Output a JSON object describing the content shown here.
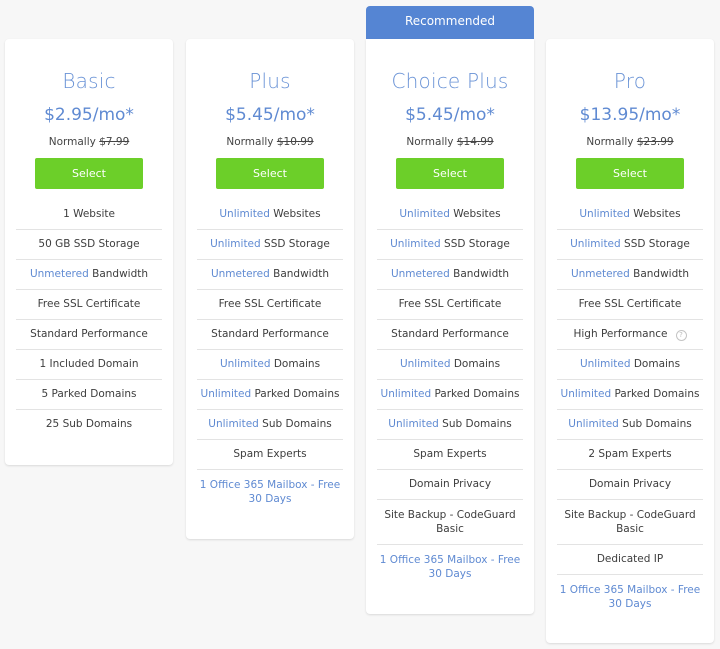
{
  "recommended_label": "Recommended",
  "plans": [
    {
      "name": "Basic",
      "price": "$2.95/mo*",
      "normally_label": "Normally",
      "normal_price": "$7.99",
      "select_label": "Select",
      "features": [
        {
          "hl": "",
          "text": "1 Website"
        },
        {
          "hl": "",
          "text": "50 GB SSD Storage"
        },
        {
          "hl": "Unmetered",
          "text": " Bandwidth"
        },
        {
          "hl": "",
          "text": "Free SSL Certificate"
        },
        {
          "hl": "",
          "text": "Standard Performance"
        },
        {
          "hl": "",
          "text": "1 Included Domain"
        },
        {
          "hl": "",
          "text": "5 Parked Domains"
        },
        {
          "hl": "",
          "text": "25 Sub Domains"
        }
      ]
    },
    {
      "name": "Plus",
      "price": "$5.45/mo*",
      "normally_label": "Normally",
      "normal_price": "$10.99",
      "select_label": "Select",
      "features": [
        {
          "hl": "Unlimited",
          "text": " Websites"
        },
        {
          "hl": "Unlimited",
          "text": " SSD Storage"
        },
        {
          "hl": "Unmetered",
          "text": " Bandwidth"
        },
        {
          "hl": "",
          "text": "Free SSL Certificate"
        },
        {
          "hl": "",
          "text": "Standard Performance"
        },
        {
          "hl": "Unlimited",
          "text": " Domains"
        },
        {
          "hl": "Unlimited",
          "text": " Parked Domains"
        },
        {
          "hl": "Unlimited",
          "text": " Sub Domains"
        },
        {
          "hl": "",
          "text": "Spam Experts"
        },
        {
          "hl": "1 Office 365 Mailbox - Free 30 Days",
          "text": ""
        }
      ]
    },
    {
      "name": "Choice Plus",
      "price": "$5.45/mo*",
      "normally_label": "Normally",
      "normal_price": "$14.99",
      "select_label": "Select",
      "features": [
        {
          "hl": "Unlimited",
          "text": " Websites"
        },
        {
          "hl": "Unlimited",
          "text": " SSD Storage"
        },
        {
          "hl": "Unmetered",
          "text": " Bandwidth"
        },
        {
          "hl": "",
          "text": "Free SSL Certificate"
        },
        {
          "hl": "",
          "text": "Standard Performance"
        },
        {
          "hl": "Unlimited",
          "text": " Domains"
        },
        {
          "hl": "Unlimited",
          "text": " Parked Domains"
        },
        {
          "hl": "Unlimited",
          "text": " Sub Domains"
        },
        {
          "hl": "",
          "text": "Spam Experts"
        },
        {
          "hl": "",
          "text": "Domain Privacy"
        },
        {
          "hl": "",
          "text": "Site Backup - CodeGuard Basic"
        },
        {
          "hl": "1 Office 365 Mailbox - Free 30 Days",
          "text": ""
        }
      ]
    },
    {
      "name": "Pro",
      "price": "$13.95/mo*",
      "normally_label": "Normally",
      "normal_price": "$23.99",
      "select_label": "Select",
      "features": [
        {
          "hl": "Unlimited",
          "text": " Websites"
        },
        {
          "hl": "Unlimited",
          "text": " SSD Storage"
        },
        {
          "hl": "Unmetered",
          "text": " Bandwidth"
        },
        {
          "hl": "",
          "text": "Free SSL Certificate"
        },
        {
          "hl": "",
          "text": "High Performance",
          "help": "?"
        },
        {
          "hl": "Unlimited",
          "text": " Domains"
        },
        {
          "hl": "Unlimited",
          "text": " Parked Domains"
        },
        {
          "hl": "Unlimited",
          "text": " Sub Domains"
        },
        {
          "hl": "",
          "text": "2 Spam Experts"
        },
        {
          "hl": "",
          "text": "Domain Privacy"
        },
        {
          "hl": "",
          "text": "Site Backup - CodeGuard Basic"
        },
        {
          "hl": "",
          "text": "Dedicated IP"
        },
        {
          "hl": "1 Office 365 Mailbox - Free 30 Days",
          "text": ""
        }
      ]
    }
  ]
}
